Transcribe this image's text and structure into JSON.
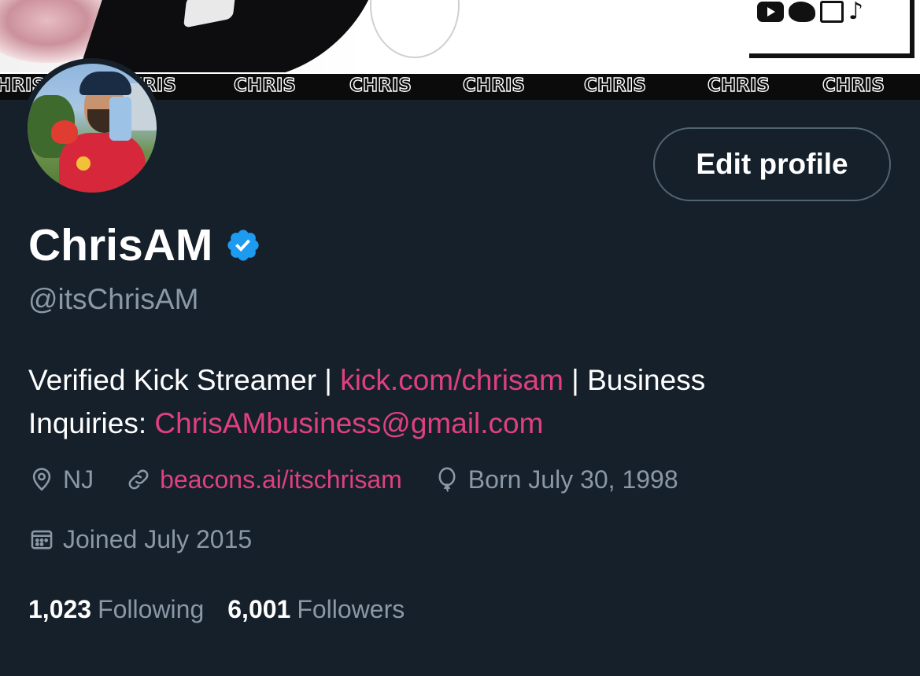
{
  "banner": {
    "strip_words": [
      "CHRIS",
      "CHRIS",
      "CHRIS",
      "CHRIS",
      "CHRIS",
      "CHRIS",
      "CHRIS",
      "CHRIS"
    ],
    "social_icons": [
      "youtube-icon",
      "twitter-icon",
      "twitch-icon",
      "tiktok-icon"
    ]
  },
  "profile": {
    "display_name": "ChrisAM",
    "verified": true,
    "handle": "@itsChrisAM",
    "edit_button_label": "Edit profile"
  },
  "bio": {
    "part1": "Verified Kick Streamer | ",
    "link1": "kick.com/chrisam",
    "part2": " | Business Inquiries: ",
    "link2": "ChrisAMbusiness@gmail.com"
  },
  "meta": {
    "location": "NJ",
    "website": "beacons.ai/itschrisam",
    "birthday": "Born July 30, 1998",
    "joined": "Joined July 2015"
  },
  "stats": {
    "following_count": "1,023",
    "following_label": "Following",
    "followers_count": "6,001",
    "followers_label": "Followers"
  },
  "colors": {
    "background": "#15202b",
    "secondary_text": "#8b98a5",
    "link": "#e0407e",
    "verified_badge": "#1d9bf0",
    "button_border": "#536471"
  }
}
